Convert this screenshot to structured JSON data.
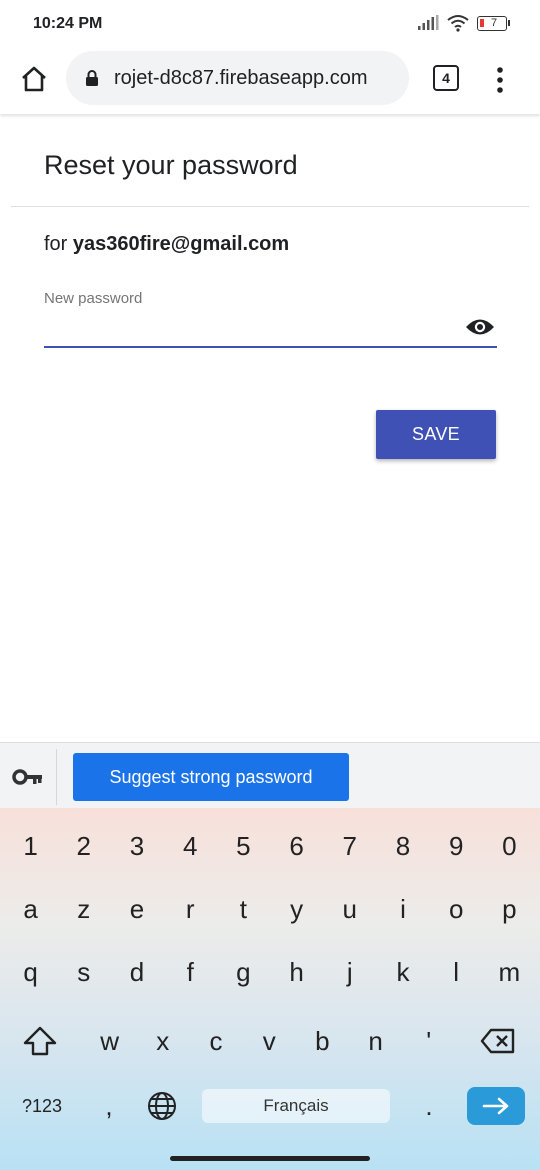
{
  "status_bar": {
    "time": "10:24 PM",
    "battery": "7"
  },
  "browser": {
    "url": "rojet-d8c87.firebaseapp.com",
    "tab_count": "4"
  },
  "page": {
    "title": "Reset your password",
    "for_prefix": "for",
    "email": "yas360fire@gmail.com",
    "field_label": "New password",
    "password_value": "",
    "save_label": "SAVE"
  },
  "keyboard": {
    "suggest_label": "Suggest strong password",
    "row_numbers": [
      "1",
      "2",
      "3",
      "4",
      "5",
      "6",
      "7",
      "8",
      "9",
      "0"
    ],
    "row_1": [
      "a",
      "z",
      "e",
      "r",
      "t",
      "y",
      "u",
      "i",
      "o",
      "p"
    ],
    "row_2": [
      "q",
      "s",
      "d",
      "f",
      "g",
      "h",
      "j",
      "k",
      "l",
      "m"
    ],
    "row_3": [
      "w",
      "x",
      "c",
      "v",
      "b",
      "n",
      "'"
    ],
    "symbols_label": "?123",
    "comma": ",",
    "space_label": "Français",
    "period": "."
  },
  "colors": {
    "accent": "#3f51b5",
    "suggest": "#1a73e8",
    "enter": "#2b9ad8"
  },
  "icons": [
    "home-icon",
    "lock-icon",
    "tabs-icon",
    "more-vert-icon",
    "eye-icon",
    "key-icon",
    "shift-icon",
    "backspace-icon",
    "globe-icon",
    "arrow-right-icon",
    "wifi-icon",
    "signal-icon",
    "battery-icon"
  ]
}
